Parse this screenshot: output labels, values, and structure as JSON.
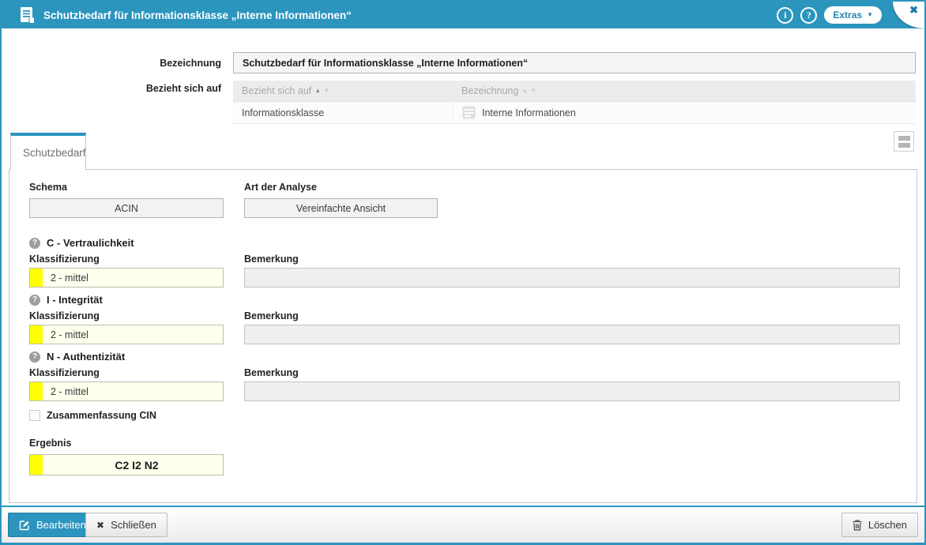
{
  "titlebar": {
    "title": "Schutzbedarf für Informationsklasse „Interne Informationen“",
    "extras_label": "Extras"
  },
  "icons": {
    "info": "i",
    "help": "?",
    "caret": "▼",
    "close": "✖",
    "cross": "✖",
    "sort_asc": "▲",
    "sort_desc": "▼",
    "section_help": "?"
  },
  "form": {
    "bezeichnung": {
      "label": "Bezeichnung",
      "value": "Schutzbedarf für Informationsklasse „Interne Informationen“"
    },
    "relation": {
      "label": "Bezieht sich auf",
      "columns": [
        {
          "label": "Bezieht sich auf"
        },
        {
          "label": "Bezeichnung"
        }
      ],
      "row": {
        "type": "Informationsklasse",
        "name": "Interne Informationen"
      }
    }
  },
  "tabs": {
    "schutzbedarf": "Schutzbedarf"
  },
  "panel": {
    "schema": {
      "label": "Schema",
      "value": "ACIN"
    },
    "analyse": {
      "label": "Art der Analyse",
      "value": "Vereinfachte Ansicht"
    },
    "sections": [
      {
        "title": "C - Vertraulichkeit",
        "klass_label": "Klassifizierung",
        "klass_value": "2 - mittel",
        "bemerkung_label": "Bemerkung",
        "bemerkung_value": ""
      },
      {
        "title": "I - Integrität",
        "klass_label": "Klassifizierung",
        "klass_value": "2 - mittel",
        "bemerkung_label": "Bemerkung",
        "bemerkung_value": ""
      },
      {
        "title": "N - Authentizität",
        "klass_label": "Klassifizierung",
        "klass_value": "2 - mittel",
        "bemerkung_label": "Bemerkung",
        "bemerkung_value": ""
      }
    ],
    "summary_checkbox": {
      "label": "Zusammenfassung CIN",
      "checked": false
    },
    "ergebnis": {
      "label": "Ergebnis",
      "value": "C2 I2 N2"
    }
  },
  "footer": {
    "edit_label": "Bearbeiten",
    "close_label": "Schließen",
    "delete_label": "Löschen"
  },
  "colors": {
    "accent_blue": "#2b95be",
    "highlight_yellow": "#ffff00",
    "field_yellow_bg": "#ffffee"
  }
}
